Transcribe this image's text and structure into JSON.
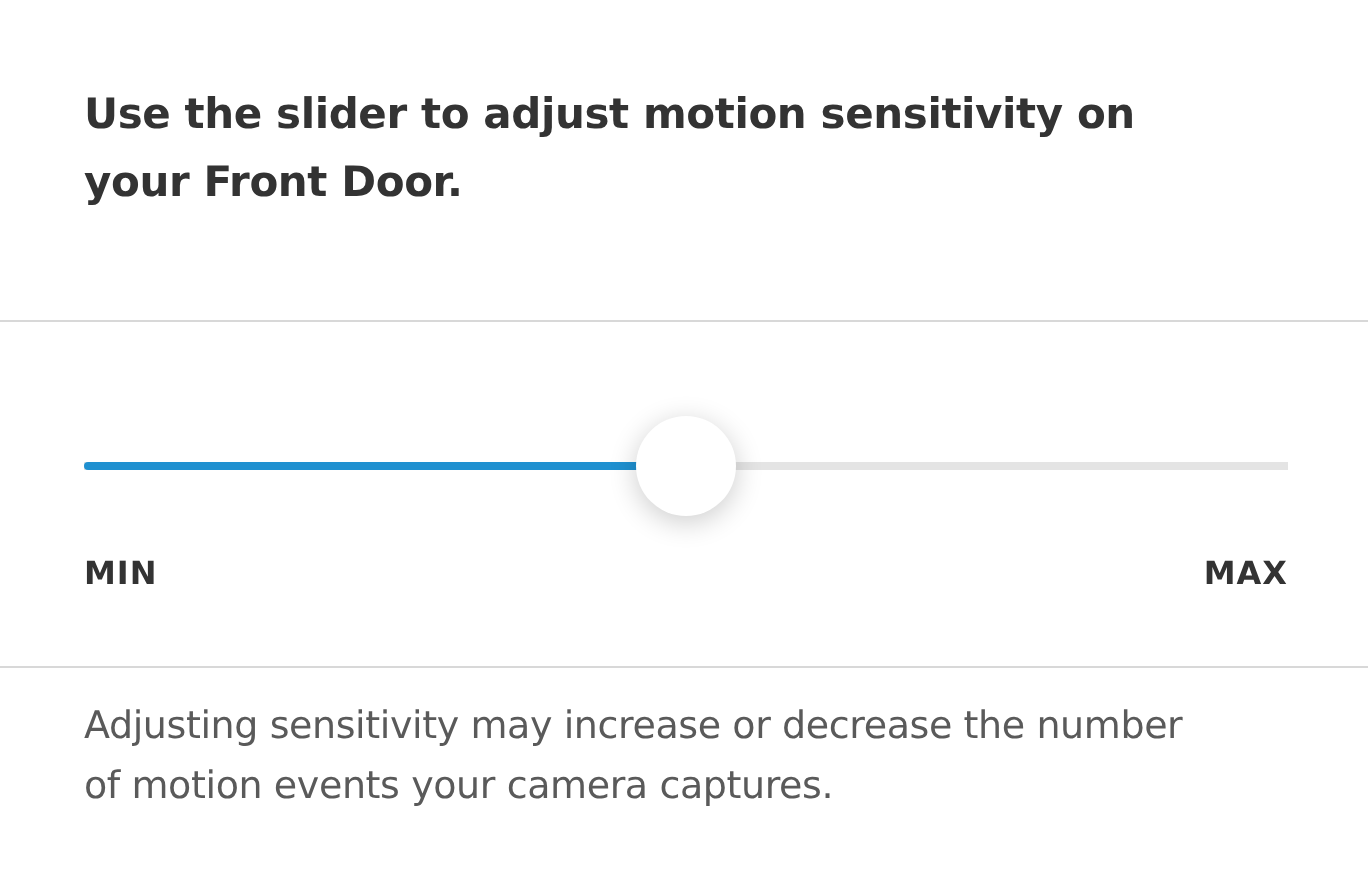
{
  "heading": "Use the slider to adjust motion sensitivity on your Front Door.",
  "slider": {
    "level": 0.5,
    "min_label": "MIN",
    "max_label": "MAX"
  },
  "description": "Adjusting sensitivity may increase or decrease the number of motion events your camera captures."
}
